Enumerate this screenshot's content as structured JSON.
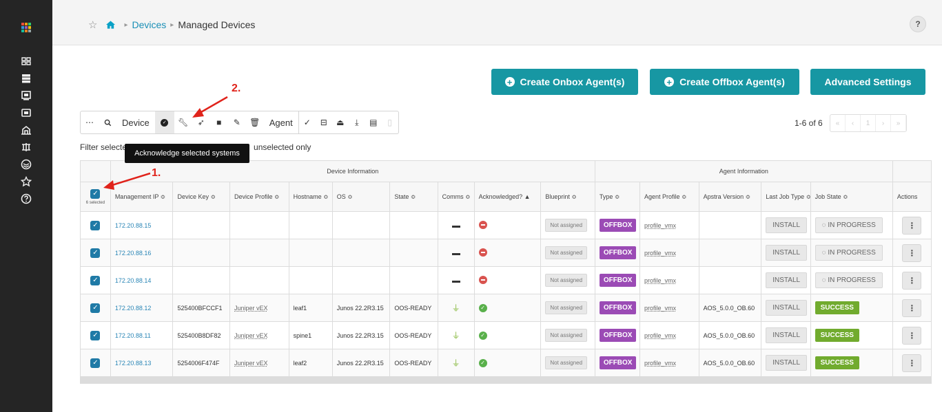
{
  "header": {
    "breadcrumb": [
      "Devices",
      "Managed Devices"
    ],
    "help_label": "?"
  },
  "actions": {
    "create_onbox": "Create Onbox Agent(s)",
    "create_offbox": "Create Offbox Agent(s)",
    "advanced_settings": "Advanced Settings"
  },
  "toolbar": {
    "more_label": "⋯",
    "device_label": "Device",
    "agent_label": "Agent"
  },
  "tooltip": "Acknowledge selected systems",
  "filter_text": "Filter selecte",
  "filter_text_rest": "unselected only",
  "pagination": {
    "range": "1-6 of 6",
    "controls": [
      "«",
      "‹",
      "1",
      "›",
      "»"
    ]
  },
  "table": {
    "groups": {
      "device": "Device Information",
      "agent": "Agent Information"
    },
    "selected_count": "6 selected",
    "columns": [
      "Management IP ≎",
      "Device Key ≎",
      "Device Profile ≎",
      "Hostname ≎",
      "OS ≎",
      "State ≎",
      "Comms ≎",
      "Acknowledged? ▲",
      "Blueprint ≎",
      "Type ≎",
      "Agent Profile ≎",
      "Apstra Version ≎",
      "Last Job Type ≎",
      "Job State ≎",
      "Actions"
    ],
    "rows": [
      {
        "ip": "172.20.88.15",
        "key": "",
        "profile": "",
        "hostname": "",
        "os": "",
        "state": "",
        "comms": "none",
        "ack": "no",
        "blueprint": "Not assigned",
        "type": "OFFBOX",
        "agent_profile": "profile_vmx",
        "version": "",
        "job_type": "INSTALL",
        "job_state": "IN PROGRESS",
        "job_status": "progress"
      },
      {
        "ip": "172.20.88.16",
        "key": "",
        "profile": "",
        "hostname": "",
        "os": "",
        "state": "",
        "comms": "none",
        "ack": "no",
        "blueprint": "Not assigned",
        "type": "OFFBOX",
        "agent_profile": "profile_vmx",
        "version": "",
        "job_type": "INSTALL",
        "job_state": "IN PROGRESS",
        "job_status": "progress"
      },
      {
        "ip": "172.20.88.14",
        "key": "",
        "profile": "",
        "hostname": "",
        "os": "",
        "state": "",
        "comms": "none",
        "ack": "no",
        "blueprint": "Not assigned",
        "type": "OFFBOX",
        "agent_profile": "profile_vmx",
        "version": "",
        "job_type": "INSTALL",
        "job_state": "IN PROGRESS",
        "job_status": "progress"
      },
      {
        "ip": "172.20.88.12",
        "key": "525400BFCCF1",
        "profile": "Juniper vEX",
        "hostname": "leaf1",
        "os": "Junos 22.2R3.15",
        "state": "OOS-READY",
        "comms": "plug",
        "ack": "yes",
        "blueprint": "Not assigned",
        "type": "OFFBOX",
        "agent_profile": "profile_vmx",
        "version": "AOS_5.0.0_OB.60",
        "job_type": "INSTALL",
        "job_state": "SUCCESS",
        "job_status": "success"
      },
      {
        "ip": "172.20.88.11",
        "key": "525400B8DF82",
        "profile": "Juniper vEX",
        "hostname": "spine1",
        "os": "Junos 22.2R3.15",
        "state": "OOS-READY",
        "comms": "plug",
        "ack": "yes",
        "blueprint": "Not assigned",
        "type": "OFFBOX",
        "agent_profile": "profile_vmx",
        "version": "AOS_5.0.0_OB.60",
        "job_type": "INSTALL",
        "job_state": "SUCCESS",
        "job_status": "success"
      },
      {
        "ip": "172.20.88.13",
        "key": "5254006F474F",
        "profile": "Juniper vEX",
        "hostname": "leaf2",
        "os": "Junos 22.2R3.15",
        "state": "OOS-READY",
        "comms": "plug",
        "ack": "yes",
        "blueprint": "Not assigned",
        "type": "OFFBOX",
        "agent_profile": "profile_vmx",
        "version": "AOS_5.0.0_OB.60",
        "job_type": "INSTALL",
        "job_state": "SUCCESS",
        "job_status": "success"
      }
    ]
  },
  "annotations": {
    "step1": "1.",
    "step2": "2."
  },
  "colors": {
    "sidebar": "#252525",
    "teal": "#1797a3",
    "offbox": "#9b4bb5",
    "success": "#71ab2e",
    "link": "#2a86b6",
    "annotation": "#e0231b"
  },
  "icons": {
    "sidebar": [
      "dashboard-icon",
      "devices-icon",
      "design-icon",
      "resources-icon",
      "external-systems-icon",
      "blueprints-icon",
      "favorites-icon",
      "help-icon"
    ]
  }
}
